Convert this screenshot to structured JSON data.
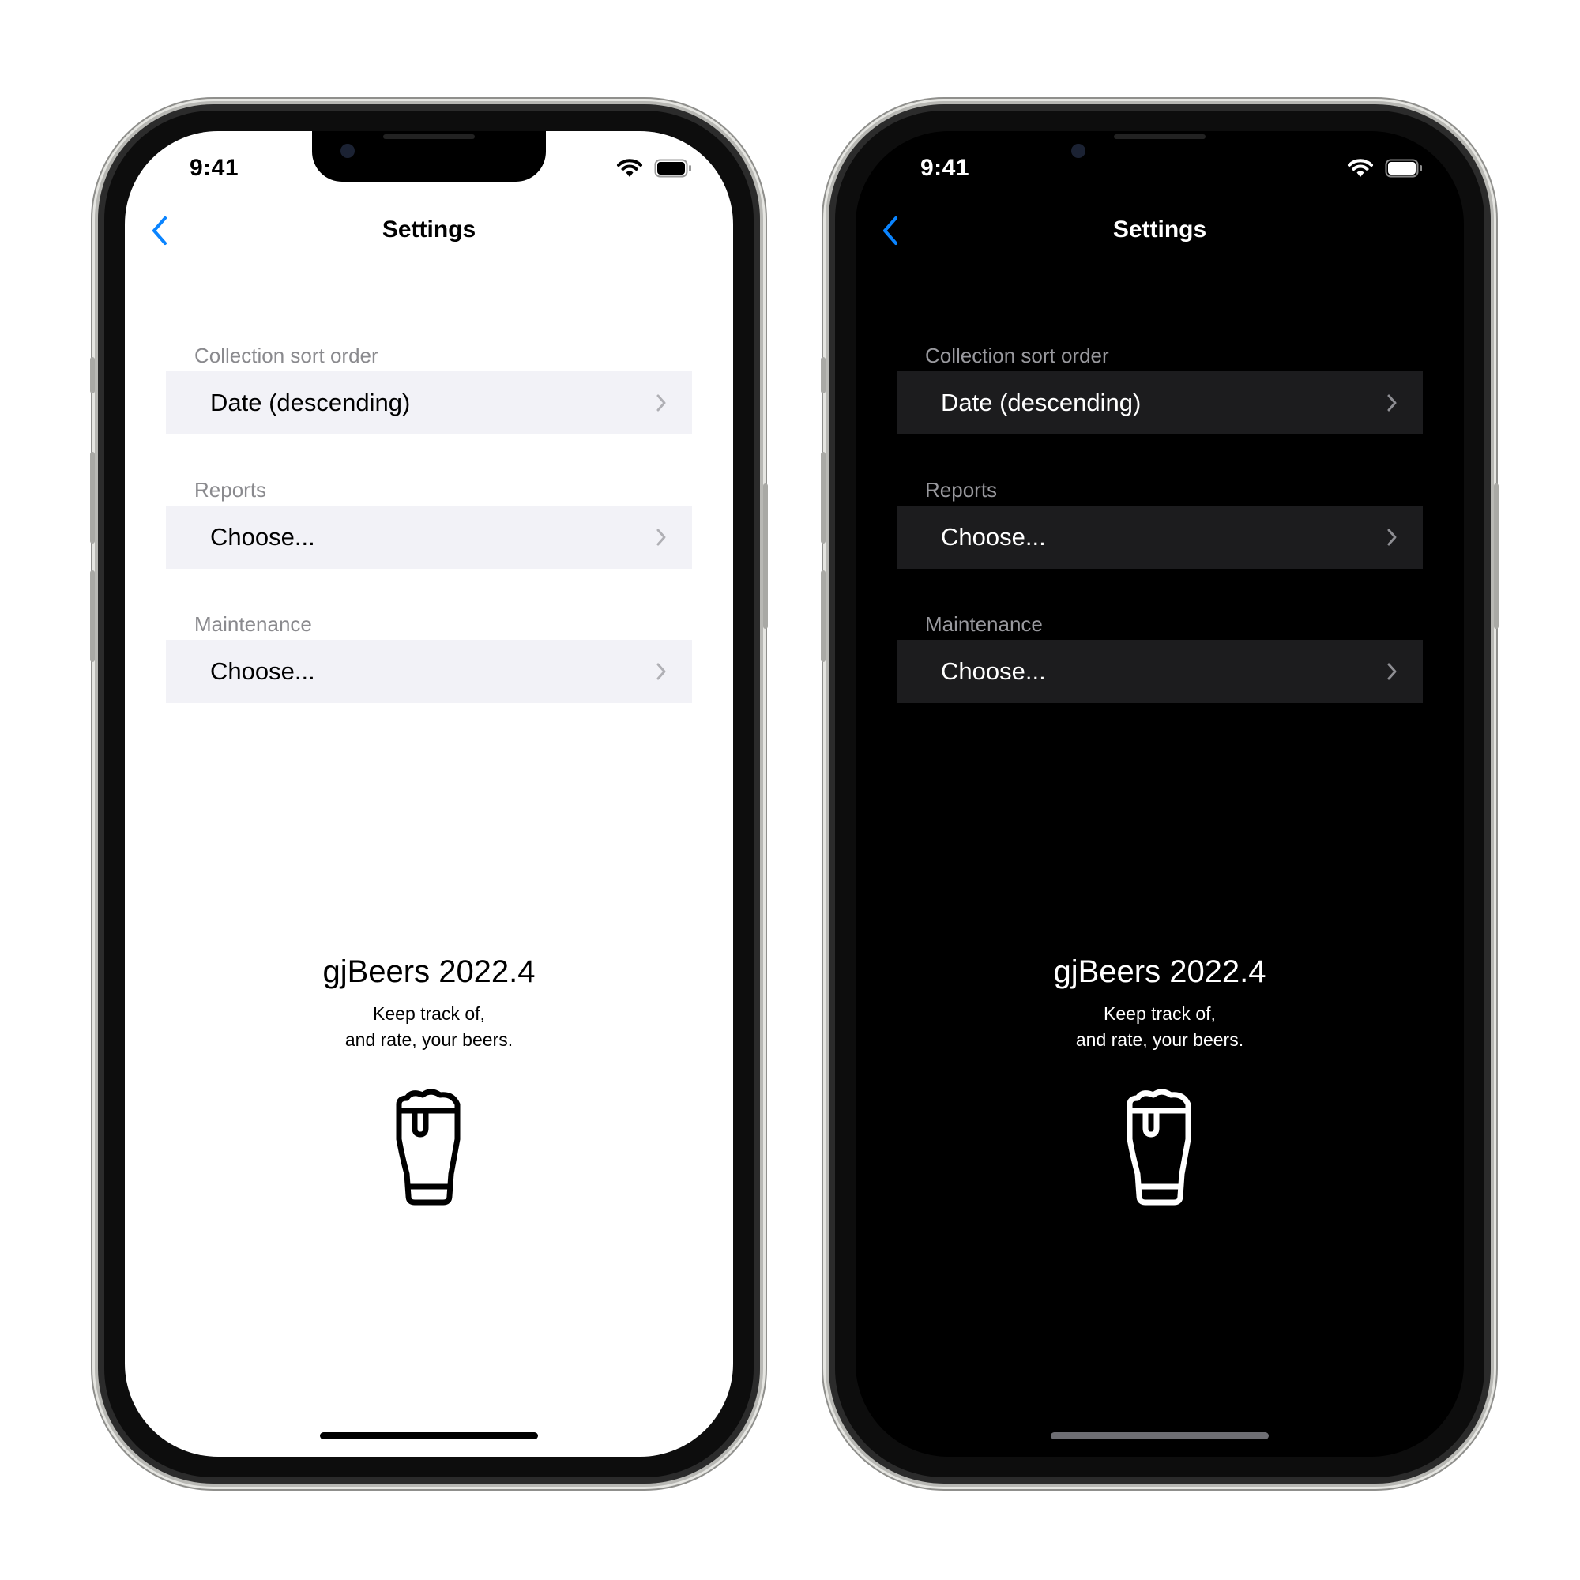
{
  "status_bar": {
    "time": "9:41"
  },
  "nav": {
    "title": "Settings"
  },
  "sections": [
    {
      "header": "Collection sort order",
      "value": "Date (descending)"
    },
    {
      "header": "Reports",
      "value": "Choose..."
    },
    {
      "header": "Maintenance",
      "value": "Choose..."
    }
  ],
  "footer": {
    "app_name": "gjBeers 2022.4",
    "tagline_line1": "Keep track of,",
    "tagline_line2": "and rate, your beers."
  },
  "icons": {
    "back": "chevron-left-icon",
    "row_disclosure": "chevron-right-icon",
    "wifi": "wifi-icon",
    "battery": "battery-icon",
    "logo": "beer-glass-icon"
  },
  "colors": {
    "accent": "#0a84ff",
    "light_row": "#f2f2f7",
    "dark_row": "#1c1c1e",
    "light_background": "#ffffff",
    "dark_background": "#000000"
  },
  "themes": [
    "light",
    "dark"
  ]
}
